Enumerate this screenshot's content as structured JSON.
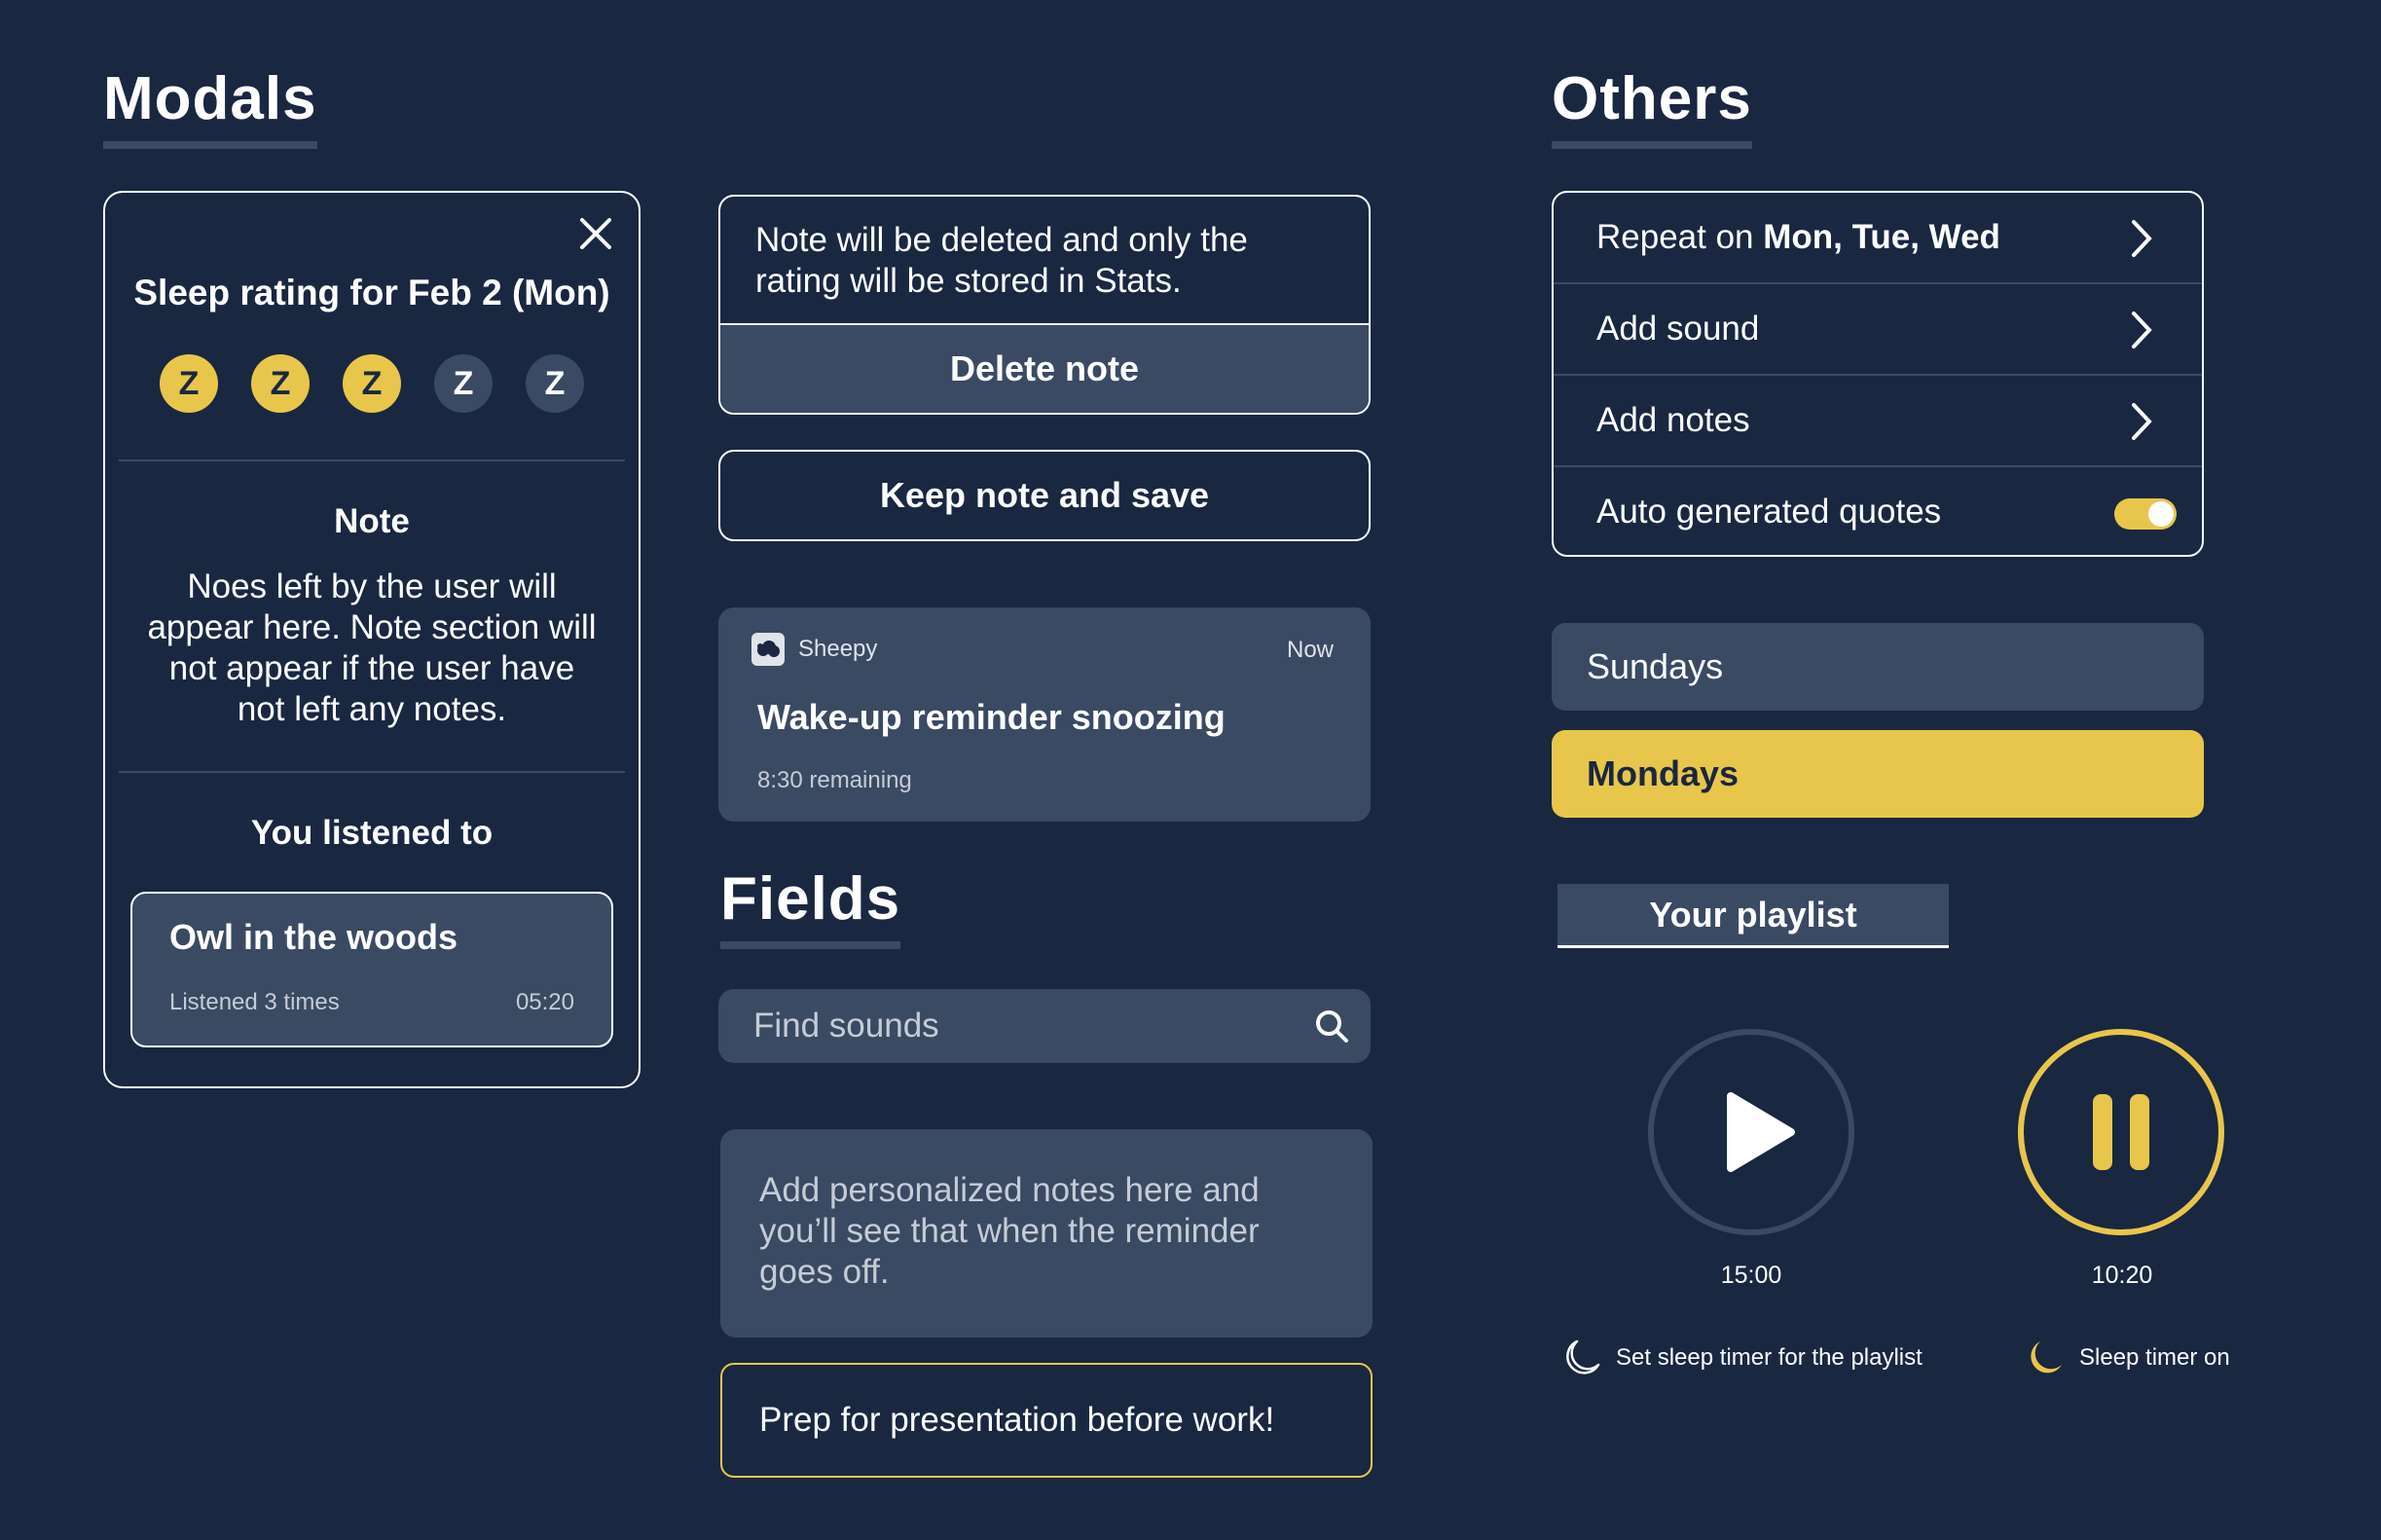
{
  "colors": {
    "background": "#192741",
    "panel": "#3a4a63",
    "accent": "#e8c64b",
    "text": "#ffffff"
  },
  "sections": {
    "modals": "Modals",
    "fields": "Fields",
    "others": "Others"
  },
  "modal": {
    "title": "Sleep rating for Feb 2 (Mon)",
    "rating": {
      "value": 3,
      "max": 5,
      "symbol": "Z"
    },
    "note_heading": "Note",
    "note_body": "Noes left by the user will appear here. Note section will not appear if the user have not left any notes.",
    "listened_heading": "You listened to",
    "track": {
      "title": "Owl in the woods",
      "plays": "Listened 3 times",
      "duration": "05:20"
    }
  },
  "delete_dialog": {
    "message": "Note will be deleted and only the rating will be stored in Stats.",
    "delete_label": "Delete note",
    "keep_label": "Keep note and save"
  },
  "notification": {
    "app": "Sheepy",
    "time": "Now",
    "title": "Wake-up reminder snoozing",
    "subtitle": "8:30 remaining"
  },
  "fields": {
    "search_placeholder": "Find sounds",
    "notes_placeholder": "Add personalized notes here and you’ll see that when the reminder goes off.",
    "note_value": "Prep for presentation before work!"
  },
  "settings": {
    "repeat_prefix": "Repeat on ",
    "repeat_days": "Mon, Tue, Wed",
    "add_sound": "Add sound",
    "add_notes": "Add notes",
    "quotes_label": "Auto generated quotes",
    "quotes_on": true
  },
  "days": {
    "sundays": "Sundays",
    "mondays": "Mondays"
  },
  "playlist": {
    "tab_label": "Your playlist"
  },
  "players": [
    {
      "time": "15:00",
      "state": "paused",
      "progress": 0,
      "timer_label": "Set sleep timer for the playlist",
      "icon": "moon-outline-icon"
    },
    {
      "time": "10:20",
      "state": "playing",
      "progress": 0.3,
      "timer_label": "Sleep timer on",
      "icon": "moon-filled-icon"
    }
  ]
}
